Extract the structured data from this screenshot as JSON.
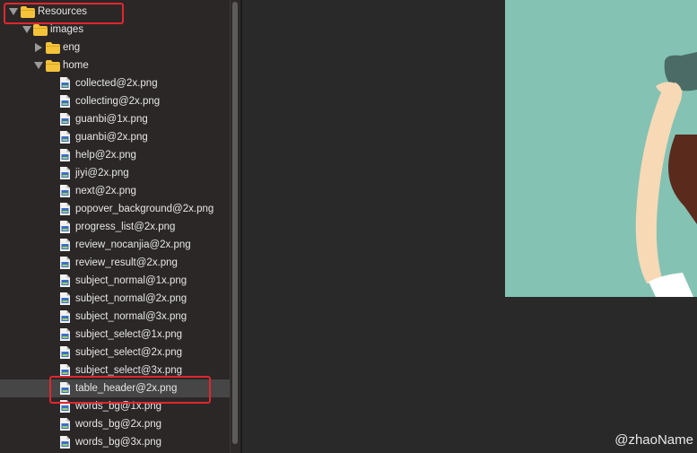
{
  "tree": {
    "root": {
      "label": "Resources"
    },
    "images": {
      "label": "images"
    },
    "eng": {
      "label": "eng"
    },
    "home": {
      "label": "home"
    },
    "files": [
      "collected@2x.png",
      "collecting@2x.png",
      "guanbi@1x.png",
      "guanbi@2x.png",
      "help@2x.png",
      "jiyi@2x.png",
      "next@2x.png",
      "popover_background@2x.png",
      "progress_list@2x.png",
      "review_nocanjia@2x.png",
      "review_result@2x.png",
      "subject_normal@1x.png",
      "subject_normal@2x.png",
      "subject_normal@3x.png",
      "subject_select@1x.png",
      "subject_select@2x.png",
      "subject_select@3x.png",
      "table_header@2x.png",
      "words_bg@1x.png",
      "words_bg@2x.png",
      "words_bg@3x.png"
    ],
    "selected_file": "table_header@2x.png"
  },
  "colors": {
    "folder": "#f5c33b",
    "highlight": "#e0262e",
    "preview_bg": "#84c2b4"
  },
  "watermark": "@zhaoName"
}
